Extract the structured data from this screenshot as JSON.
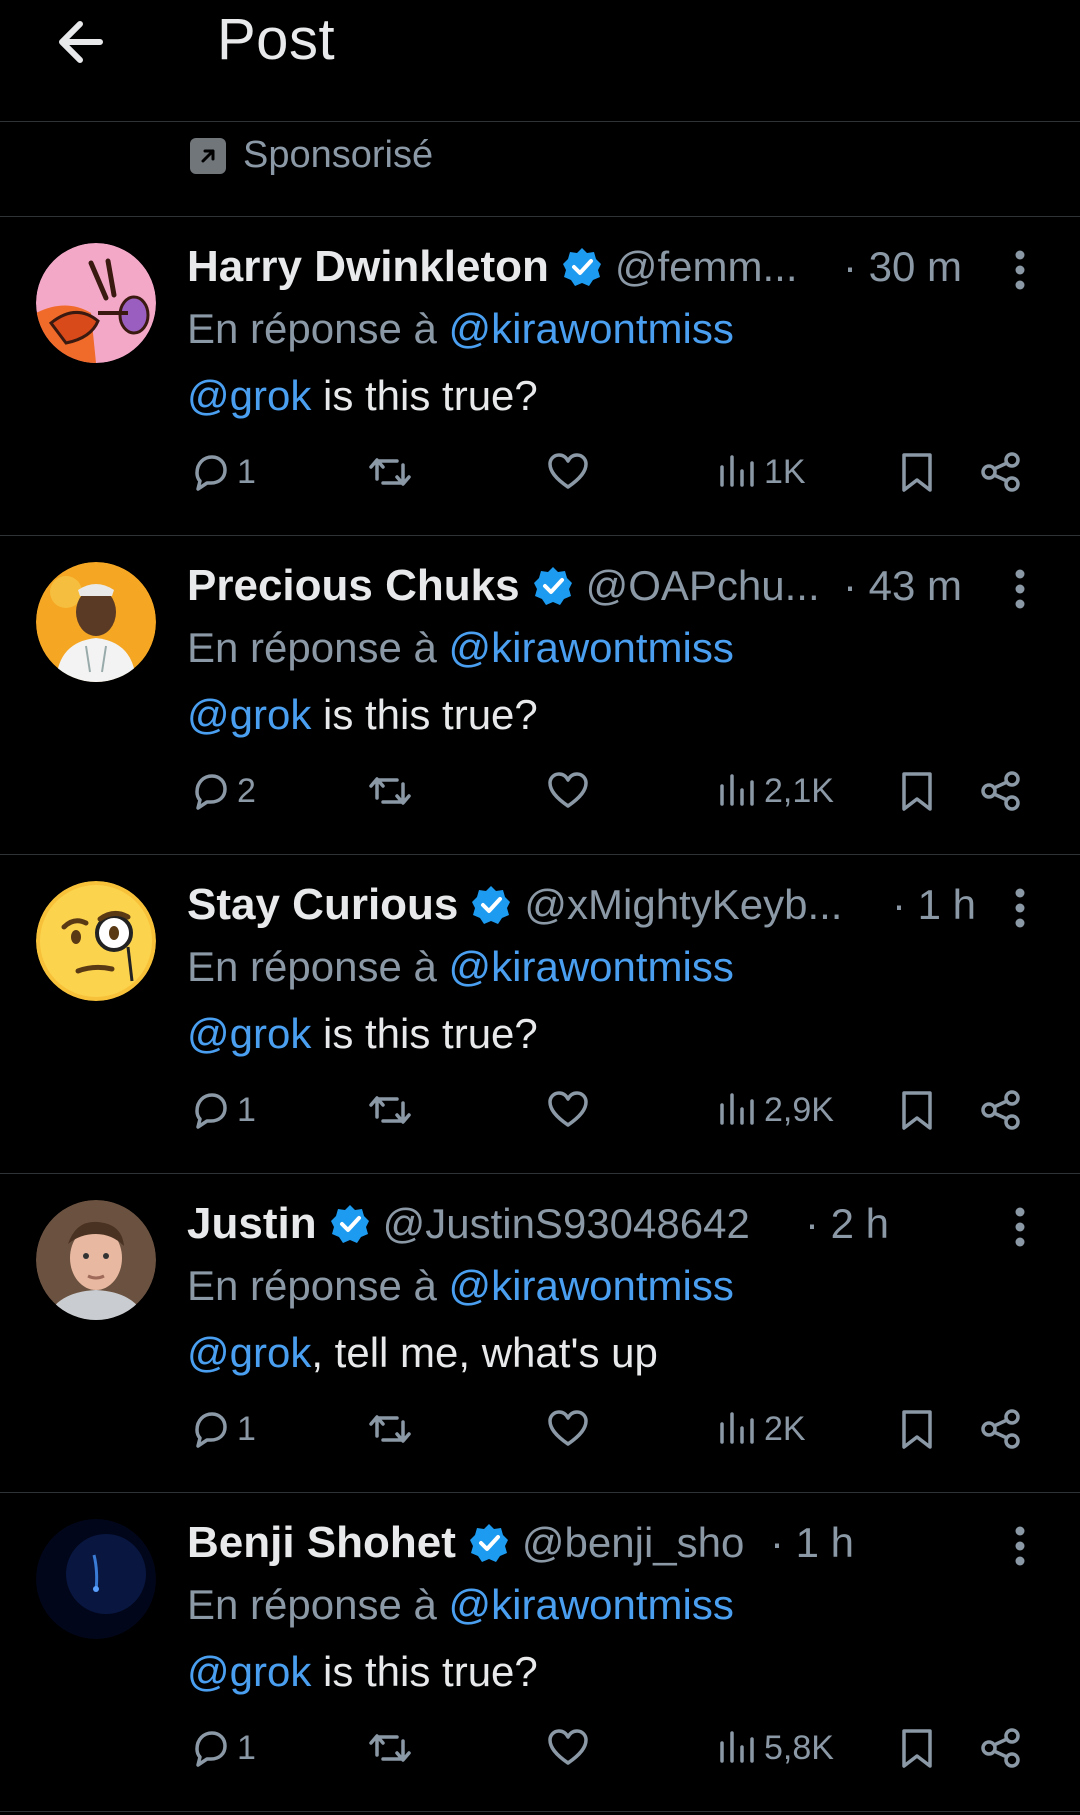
{
  "header": {
    "title": "Post"
  },
  "sponsored": {
    "label": "Sponsorisé"
  },
  "tweets": [
    {
      "name": "Harry Dwinkleton",
      "handle": "@femm...",
      "time": "· 30 m",
      "reply_prefix": "En réponse à",
      "reply_to": "@kirawontmiss",
      "mention": "@grok",
      "text": " is this true?",
      "replies": "1",
      "views": "1K"
    },
    {
      "name": "Precious Chuks",
      "handle": "@OAPchu...",
      "time": "· 43 m",
      "reply_prefix": "En réponse à",
      "reply_to": "@kirawontmiss",
      "mention": "@grok",
      "text": " is this true?",
      "replies": "2",
      "views": "2,1K"
    },
    {
      "name": "Stay Curious",
      "handle": "@xMightyKeyb...",
      "time": "· 1 h",
      "reply_prefix": "En réponse à",
      "reply_to": "@kirawontmiss",
      "mention": "@grok",
      "text": " is this true?",
      "replies": "1",
      "views": "2,9K"
    },
    {
      "name": "Justin",
      "handle": "@JustinS93048642",
      "time": "· 2 h",
      "reply_prefix": "En réponse à",
      "reply_to": "@kirawontmiss",
      "mention": "@grok",
      "text": ", tell me, what's up",
      "replies": "1",
      "views": "2K"
    },
    {
      "name": "Benji Shohet",
      "handle": "@benji_sho",
      "time": "· 1 h",
      "reply_prefix": "En réponse à",
      "reply_to": "@kirawontmiss",
      "mention": "@grok",
      "text": " is this true?",
      "replies": "1",
      "views": "5,8K"
    }
  ],
  "icons": {
    "back": "arrow-left-icon",
    "promoted": "promoted-arrow-icon",
    "verified": "verified-badge-icon",
    "more": "more-vertical-icon",
    "reply": "reply-bubble-icon",
    "retweet": "retweet-icon",
    "like": "heart-icon",
    "views": "views-bar-chart-icon",
    "bookmark": "bookmark-icon",
    "share": "share-icon"
  },
  "colors": {
    "background": "#000000",
    "text": "#e7e9ea",
    "muted": "#8b98a5",
    "link": "#4a9ff0",
    "verified": "#1d9bf0",
    "divider": "#2f3336"
  }
}
